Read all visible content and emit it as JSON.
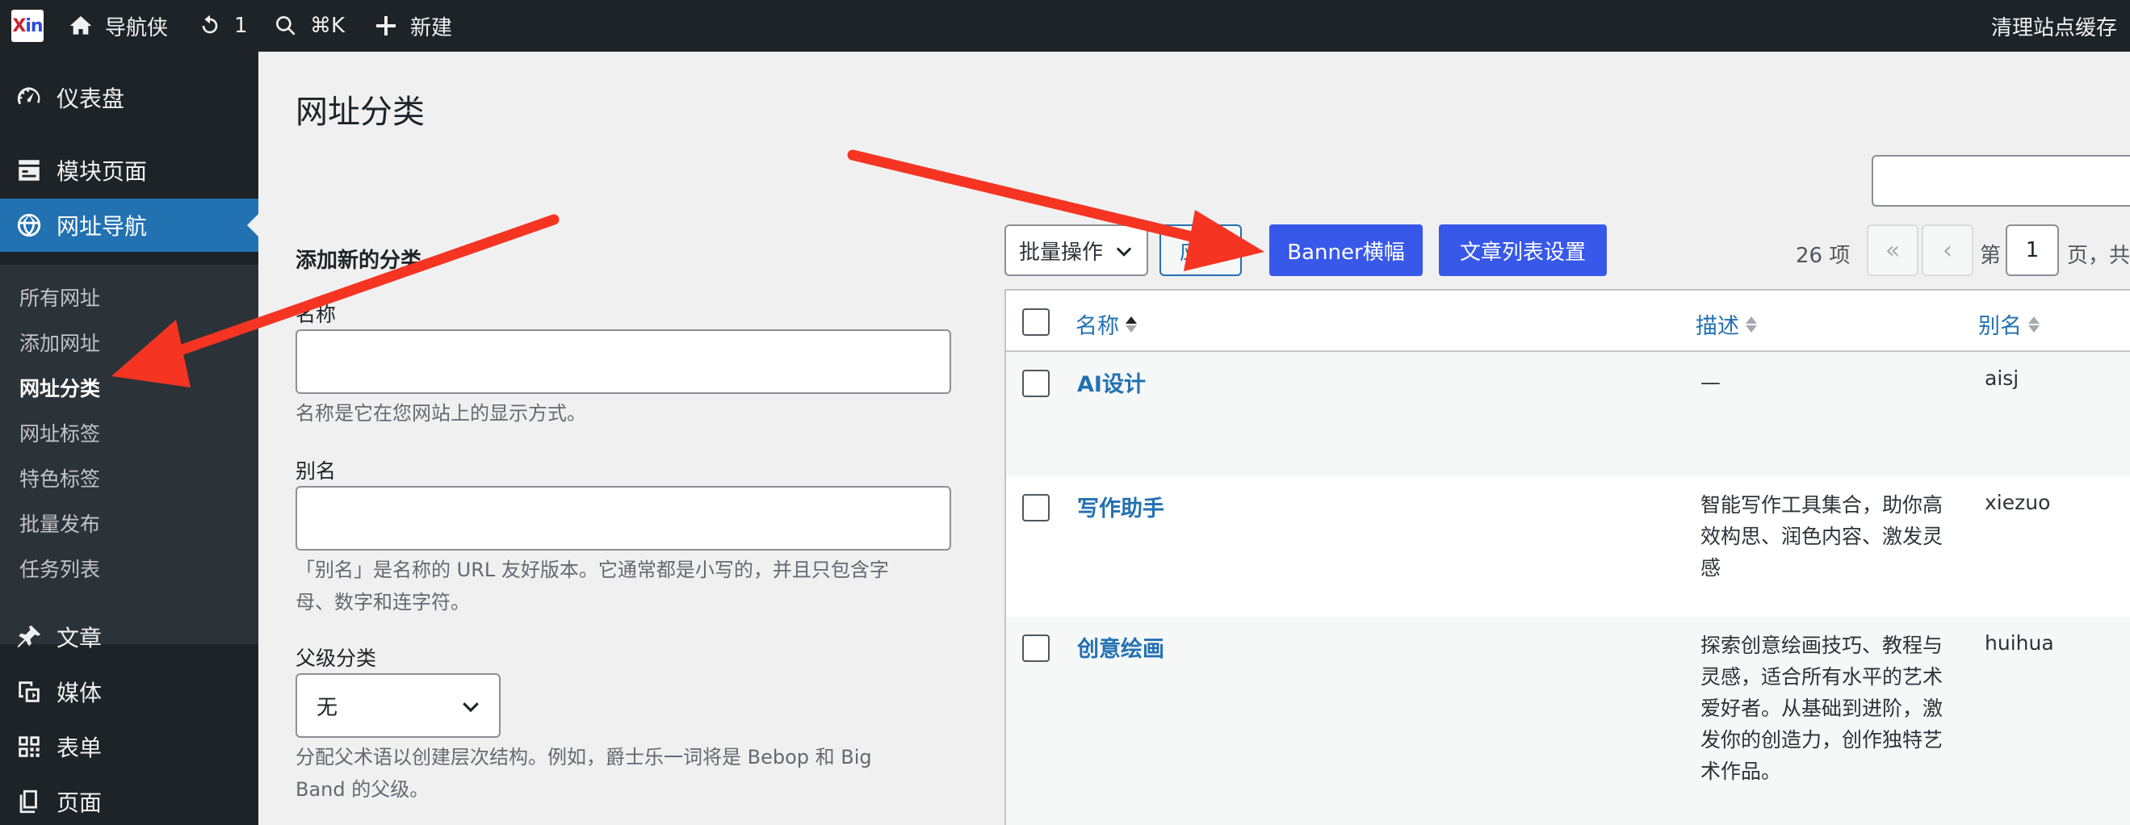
{
  "adminbar": {
    "logo_text_x": "X",
    "logo_text_in": "in",
    "site_name": "导航侠",
    "updates_count": "1",
    "search_shortcut": "⌘K",
    "new_label": "新建",
    "clear_cache": "清理站点缓存"
  },
  "sidebar": {
    "top_items": [
      {
        "label": "仪表盘",
        "icon": "dashboard-icon"
      },
      {
        "label": "模块页面",
        "icon": "module-icon"
      },
      {
        "label": "网址导航",
        "icon": "globe-icon"
      },
      {
        "label": "文章",
        "icon": "pin-icon"
      },
      {
        "label": "媒体",
        "icon": "media-icon"
      },
      {
        "label": "表单",
        "icon": "qrcode-icon"
      },
      {
        "label": "页面",
        "icon": "page-icon"
      }
    ],
    "sub_items": [
      "所有网址",
      "添加网址",
      "网址分类",
      "网址标签",
      "特色标签",
      "批量发布",
      "任务列表"
    ]
  },
  "main": {
    "title": "网址分类",
    "form": {
      "heading": "添加新的分类",
      "name_label": "名称",
      "name_value": "",
      "name_help": "名称是它在您网站上的显示方式。",
      "slug_label": "别名",
      "slug_value": "",
      "slug_help_1": "「别名」是名称的 URL 友好版本。它通常都是小写的，并且只包含字",
      "slug_help_2": "母、数字和连字符。",
      "parent_label": "父级分类",
      "parent_value": "无",
      "parent_help_1": "分配父术语以创建层次结构。例如，爵士乐一词将是 Bebop 和 Big",
      "parent_help_2": "Band 的父级。"
    },
    "tablenav": {
      "bulk_action": "批量操作",
      "apply": "应用",
      "banner_button": "Banner横幅",
      "article_settings_button": "文章列表设置",
      "items_count": "26 项",
      "first_page": "«",
      "prev_page": "‹",
      "page_prefix": "第",
      "current_page": "1",
      "page_suffix": "页，共"
    },
    "table": {
      "headers": {
        "name": "名称",
        "description": "描述",
        "slug": "别名"
      },
      "rows": [
        {
          "name": "AI设计",
          "description": "—",
          "slug": "aisj"
        },
        {
          "name": "写作助手",
          "description": "智能写作工具集合，助你高效构思、润色内容、激发灵感",
          "slug": "xiezuo"
        },
        {
          "name": "创意绘画",
          "description": "探索创意绘画技巧、教程与灵感，适合所有水平的艺术爱好者。从基础到进阶，激发你的创造力，创作独特艺术作品。",
          "slug": "huihua"
        }
      ]
    }
  },
  "colors": {
    "adminbar_bg": "#1d2327",
    "menu_current": "#2271b1",
    "primary_button": "#3858e9",
    "link": "#2271b1",
    "arrow": "#f53422"
  }
}
